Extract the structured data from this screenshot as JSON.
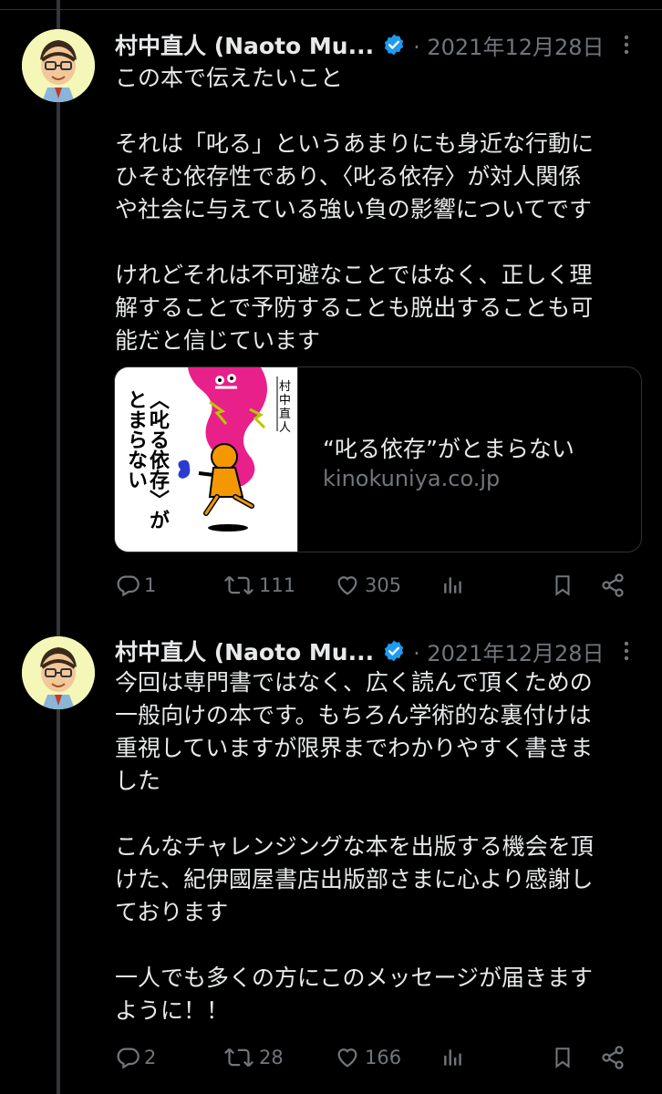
{
  "tweets": [
    {
      "author": "村中直人 (Naoto Mu...",
      "date": "· 2021年12月28日",
      "lines": [
        "この本で伝えたいこと",
        "",
        "それは「叱る」というあまりにも身近な行動に",
        "ひそむ依存性であり、〈叱る依存〉が対人関係",
        "や社会に与えている強い負の影響についてです",
        "",
        "けれどそれは不可避なことではなく、正しく理",
        "解することで予防することも脱出することも可",
        "能だと信じています"
      ],
      "card": {
        "title": "“叱る依存”がとまらない",
        "domain": "kinokuniya.co.jp",
        "cover_title": "〈叱る依存〉がとまらない",
        "cover_author": "村中直人"
      },
      "stats": {
        "replies": "1",
        "retweets": "111",
        "likes": "305"
      }
    },
    {
      "author": "村中直人 (Naoto Mu...",
      "date": "· 2021年12月28日",
      "lines": [
        "今回は専門書ではなく、広く読んで頂くための",
        "一般向けの本です。もちろん学術的な裏付けは",
        "重視していますが限界までわかりやすく書きま",
        "した",
        "",
        "こんなチャレンジングな本を出版する機会を頂",
        "けた、紀伊國屋書店出版部さまに心より感謝し",
        "ております",
        "",
        "一人でも多くの方にこのメッセージが届きます",
        "ように！！"
      ],
      "stats": {
        "replies": "2",
        "retweets": "28",
        "likes": "166"
      }
    }
  ],
  "icons": {
    "verified": "verified-badge-icon",
    "more": "more-dots-icon",
    "reply": "reply-icon",
    "retweet": "retweet-icon",
    "like": "heart-icon",
    "views": "analytics-icon",
    "bookmark": "bookmark-icon",
    "share": "share-icon"
  },
  "colors": {
    "background": "#000000",
    "text": "#e7e9ea",
    "muted": "#71767b",
    "verified": "#1d9bf0",
    "border": "#2f3336"
  }
}
